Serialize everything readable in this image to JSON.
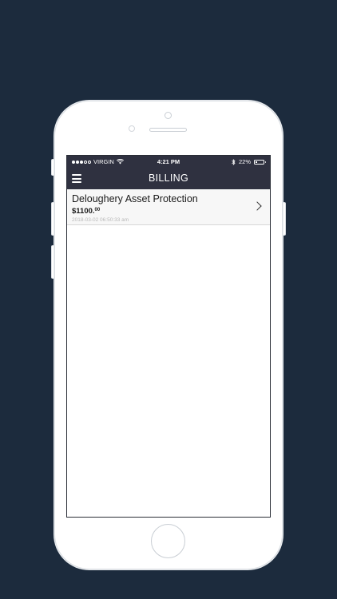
{
  "status_bar": {
    "carrier": "VIRGIN",
    "time": "4:21 PM",
    "battery_percent": "22%",
    "battery_level": 0.22,
    "signal_bars": 3,
    "signal_total": 5
  },
  "nav": {
    "title": "BILLING"
  },
  "billing": {
    "items": [
      {
        "title": "Deloughery Asset Protection",
        "amount_main": "$1100.",
        "amount_cents": "00",
        "date": "2018-03-02 06:50:33 am"
      }
    ]
  },
  "colors": {
    "background": "#1c2b3d",
    "nav_bar": "#2f3140",
    "item_background": "#f7f7f7"
  }
}
